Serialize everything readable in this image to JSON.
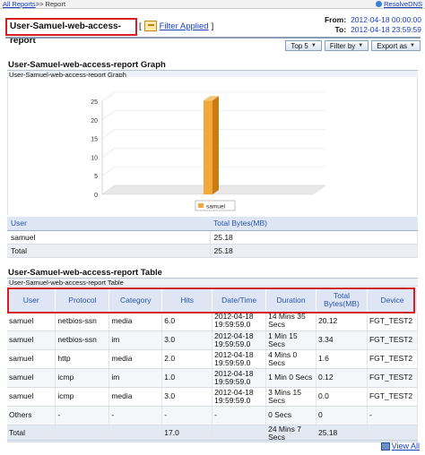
{
  "breadcrumb": {
    "link": "All Reports",
    "sep": ">>",
    "current": "Report"
  },
  "resolve_dns": "ResolveDNS",
  "report_title": "User-Samuel-web-access-report",
  "filter": {
    "open": "[",
    "label": "Filter Applied",
    "close": "]"
  },
  "dates": {
    "from_label": "From:",
    "from_value": "2012-04-18 00:00:00",
    "to_label": "To:",
    "to_value": "2012-04-18 23:59:59"
  },
  "toolbar": {
    "top": "Top 5",
    "filter_by": "Filter by",
    "export": "Export as"
  },
  "graph_section": {
    "title": "User-Samuel-web-access-report Graph",
    "subhead": "User-Samuel-web-access-report Graph"
  },
  "chart_data": {
    "type": "bar",
    "categories": [
      "samuel"
    ],
    "values": [
      25.18
    ],
    "ylim": [
      0,
      25
    ],
    "yticks": [
      0,
      5,
      10,
      15,
      20,
      25
    ],
    "legend": "samuel",
    "colors": {
      "bar": "#f4a83a",
      "bar_dark": "#c97b14"
    }
  },
  "summary": {
    "headers": [
      "User",
      "Total Bytes(MB)"
    ],
    "rows": [
      [
        "samuel",
        "25.18"
      ]
    ],
    "total": [
      "Total",
      "25.18"
    ]
  },
  "table_section": {
    "title": "User-Samuel-web-access-report Table",
    "subhead": "User-Samuel-web-access-report Table"
  },
  "table": {
    "headers": [
      "User",
      "Protocol",
      "Category",
      "Hits",
      "Date/Time",
      "Duration",
      "Total Bytes(MB)",
      "Device"
    ],
    "rows": [
      [
        "samuel",
        "netbios-ssn",
        "media",
        "6.0",
        "2012-04-18 19:59:59.0",
        "14 Mins 35 Secs",
        "20.12",
        "FGT_TEST2"
      ],
      [
        "samuel",
        "netbios-ssn",
        "im",
        "3.0",
        "2012-04-18 19:59:59.0",
        "1 Min 15 Secs",
        "3.34",
        "FGT_TEST2"
      ],
      [
        "samuel",
        "http",
        "media",
        "2.0",
        "2012-04-18 19:59:59.0",
        "4 Mins 0 Secs",
        "1.6",
        "FGT_TEST2"
      ],
      [
        "samuel",
        "icmp",
        "im",
        "1.0",
        "2012-04-18 19:59:59.0",
        "1 Min 0 Secs",
        "0.12",
        "FGT_TEST2"
      ],
      [
        "samuel",
        "icmp",
        "media",
        "3.0",
        "2012-04-18 19:59:59.0",
        "3 Mins 15 Secs",
        "0.0",
        "FGT_TEST2"
      ],
      [
        "Others",
        "-",
        "-",
        "-",
        "-",
        "0 Secs",
        "0",
        "-"
      ]
    ],
    "total": [
      "Total",
      "",
      "",
      "17.0",
      "",
      "24 Mins 7 Secs",
      "25.18",
      ""
    ]
  },
  "view_all": "View All"
}
